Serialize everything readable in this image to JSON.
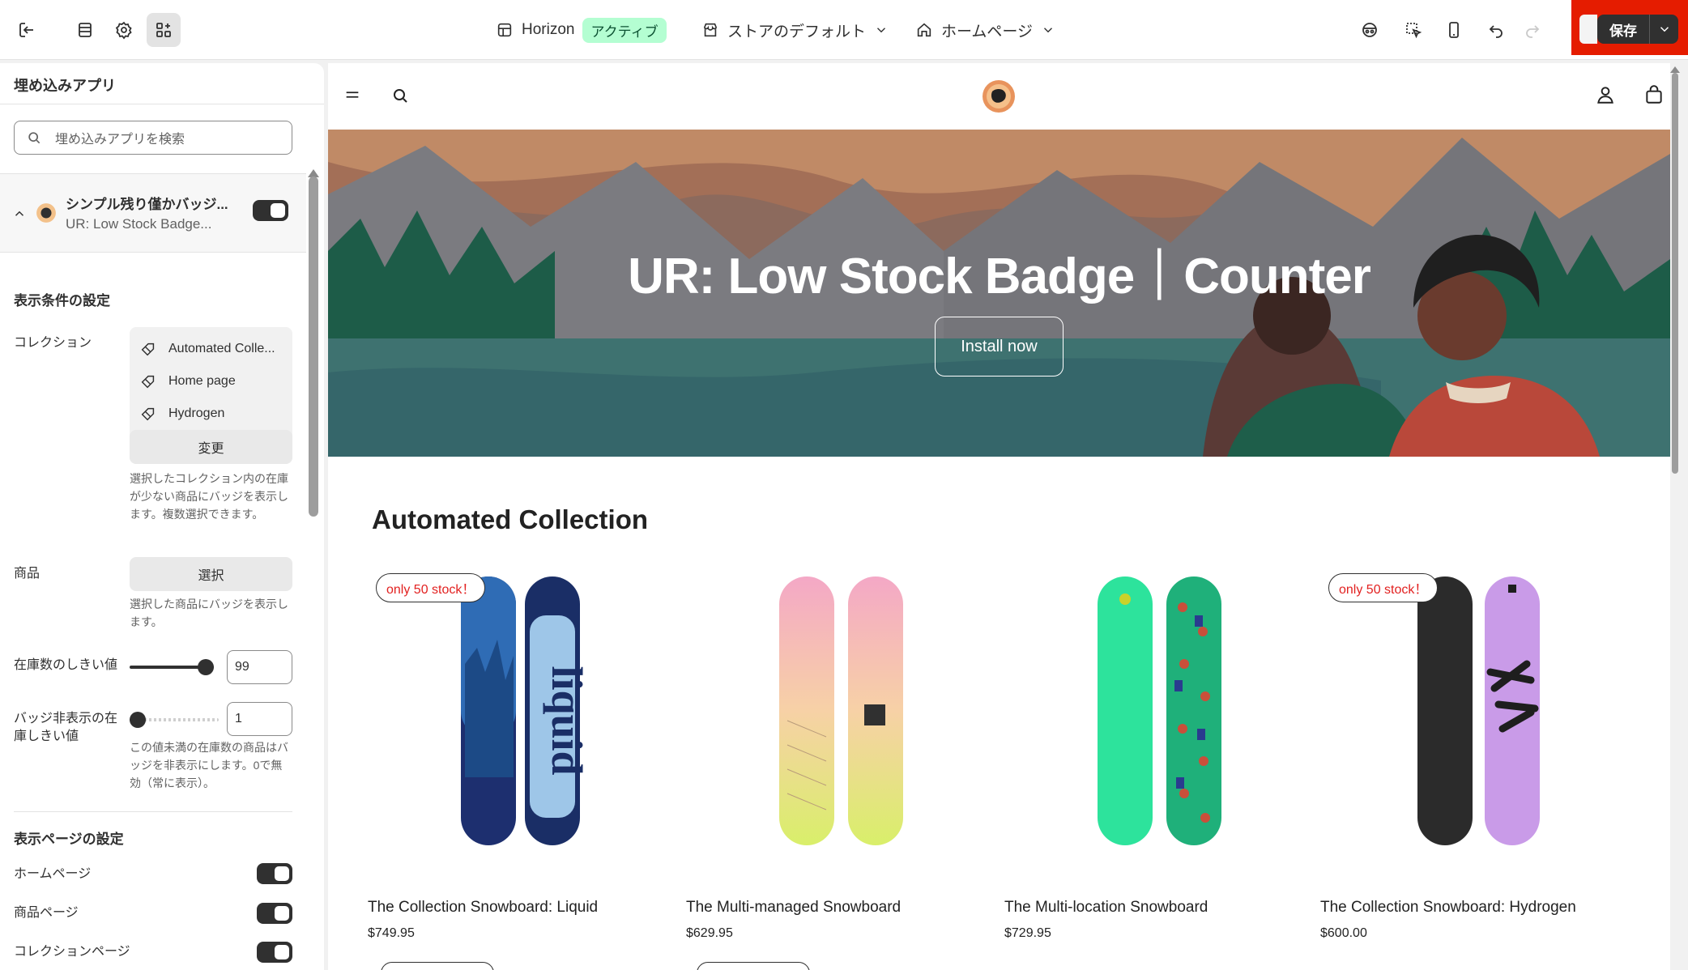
{
  "topbar": {
    "exit_icon": "exit-icon",
    "theme_name": "Horizon",
    "theme_status": "アクティブ",
    "store_context": "ストアのデフォルト",
    "page_context": "ホームページ",
    "save_label": "保存",
    "highlight_color": "#e51c00"
  },
  "sidebar": {
    "title": "埋め込みアプリ",
    "search_placeholder": "埋め込みアプリを検索",
    "app": {
      "title": "シンプル残り僅かバッジ...",
      "subtitle": "UR: Low Stock Badge...",
      "enabled": true
    },
    "display_conditions": {
      "title": "表示条件の設定",
      "collection_label": "コレクション",
      "collections": [
        "Automated Colle...",
        "Home page",
        "Hydrogen"
      ],
      "change_label": "変更",
      "collection_help": "選択したコレクション内の在庫が少ない商品にバッジを表示します。複数選択できます。",
      "product_label": "商品",
      "select_label": "選択",
      "product_help": "選択した商品にバッジを表示します。",
      "threshold_label": "在庫数のしきい値",
      "threshold_value": "99",
      "threshold_level": 0.98,
      "hide_label": "バッジ非表示の在庫しきい値",
      "hide_value": "1",
      "hide_level": 0.0,
      "hide_help": "この値未満の在庫数の商品はバッジを非表示にします。0で無効（常に表示）。"
    },
    "display_pages": {
      "title": "表示ページの設定",
      "home_label": "ホームページ",
      "product_label": "商品ページ",
      "collection_label": "コレクションページ"
    }
  },
  "preview": {
    "hero_title": "UR: Low Stock Badge｜Counter",
    "hero_button": "Install now",
    "collection_title": "Automated Collection",
    "products": [
      {
        "name": "The Collection Snowboard: Liquid",
        "price": "$749.95",
        "badge": "only 50 stock！"
      },
      {
        "name": "The Multi-managed Snowboard",
        "price": "$629.95",
        "badge": ""
      },
      {
        "name": "The Multi-location Snowboard",
        "price": "$729.95",
        "badge": ""
      },
      {
        "name": "The Collection Snowboard: Hydrogen",
        "price": "$600.00",
        "badge": "only 50 stock！"
      }
    ]
  }
}
